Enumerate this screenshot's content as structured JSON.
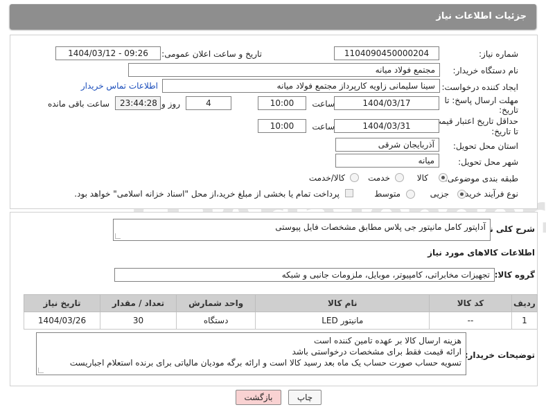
{
  "header": {
    "title": "جزئیات اطلاعات نیاز"
  },
  "form": {
    "need_number_label": "شماره نیاز:",
    "need_number": "1104090450000204",
    "announce_label": "تاریخ و ساعت اعلان عمومی:",
    "announce_value": "1404/03/12 - 09:26",
    "buyer_org_label": "نام دستگاه خریدار:",
    "buyer_org": "مجتمع فولاد میانه",
    "creator_label": "ایجاد کننده درخواست:",
    "creator": "سینا سلیمانی زاویه کارپرداز مجتمع فولاد میانه",
    "contact_link": "اطلاعات تماس خریدار",
    "deadline_label_1": "مهلت ارسال پاسخ: تا",
    "deadline_label_2": "تاریخ:",
    "deadline_date": "1404/03/17",
    "time_label": "ساعت",
    "deadline_time": "10:00",
    "days_value": "4",
    "days_label": "روز و",
    "remaining_time": "23:44:28",
    "remaining_label": "ساعت باقی مانده",
    "validity_label_1": "حداقل تاریخ اعتبار قیمت:",
    "validity_label_2": "تا تاریخ:",
    "validity_date": "1404/03/31",
    "validity_time": "10:00",
    "province_label": "استان محل تحویل:",
    "province": "آذربایجان شرقی",
    "city_label": "شهر محل تحویل:",
    "city": "میانه",
    "category_label": "طبقه بندی موضوعی:",
    "category_options": [
      "کالا",
      "خدمت",
      "کالا/خدمت"
    ],
    "process_label": "نوع فرآیند خرید :",
    "process_options": [
      "جزیی",
      "متوسط"
    ],
    "payment_note": "پرداخت تمام یا بخشی از مبلغ خرید،از محل \"اسناد خزانه اسلامی\" خواهد بود."
  },
  "summary": {
    "label": "شرح کلی نیاز:",
    "text": "آداپتور کامل مانیتور جی پلاس مطابق مشخصات فایل پیوستی"
  },
  "goods": {
    "section_title": "اطلاعات کالاهای مورد نیاز",
    "group_label": "گروه کالا:",
    "group_value": "تجهیزات مخابراتی، کامپیوتر، موبایل، ملزومات جانبی و شبکه",
    "columns": [
      "ردیف",
      "کد کالا",
      "نام کالا",
      "واحد شمارش",
      "تعداد / مقدار",
      "تاریخ نیاز"
    ],
    "rows": [
      [
        "1",
        "--",
        "مانیتور LED",
        "دستگاه",
        "30",
        "1404/03/26"
      ]
    ]
  },
  "notes": {
    "label": "توضیحات خریدار:",
    "lines": [
      "هزینه ارسال کالا بر عهده تامین کننده است",
      "ارائه قیمت فقط برای مشخصات درخواستی باشد",
      "تسویه حساب صورت حساب یک ماه بعد رسید کالا است و ارائه برگه مودیان مالیاتی برای برنده استعلام اجباریست"
    ]
  },
  "buttons": {
    "print": "چاپ",
    "back": "بازگشت"
  },
  "colors": {
    "header": "#8e8e8e",
    "link": "#1a4dbb",
    "back_button": "#f9d2d2",
    "table_header": "#cfcfcf"
  }
}
